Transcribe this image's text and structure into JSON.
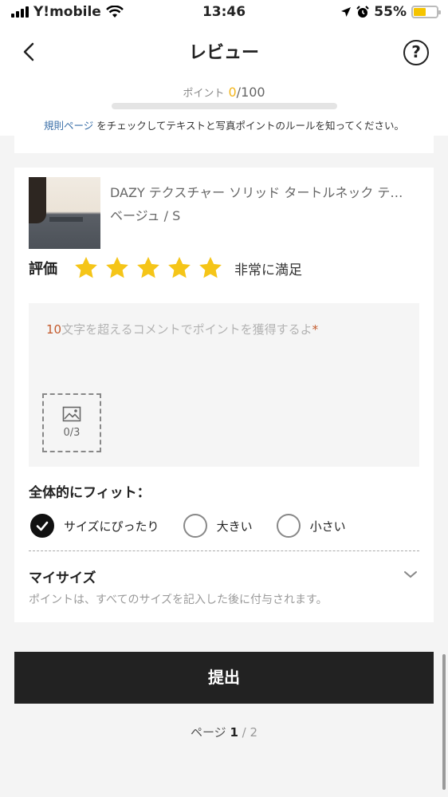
{
  "status_bar": {
    "carrier": "Y!mobile",
    "time": "13:46",
    "battery": "55%"
  },
  "header": {
    "title": "レビュー"
  },
  "points": {
    "label": "ポイント",
    "current": "0",
    "separator_total": "/100",
    "progress": 0
  },
  "rules": {
    "link_text": "規則ページ",
    "text": " をチェックしてテキストと写真ポイントのルールを知ってください。"
  },
  "product": {
    "name": "DAZY テクスチャー ソリッド タートルネック テ…",
    "variant": "ベージュ / S"
  },
  "rating": {
    "label": "評価",
    "stars_filled": 5,
    "stars_total": 5,
    "text": "非常に満足",
    "star_color": "#f5c518"
  },
  "comment": {
    "min_chars": "10",
    "placeholder": "文字を超えるコメントでポイントを獲得するよ",
    "required_mark": "*",
    "upload_count": "0/3"
  },
  "fit": {
    "title": "全体的にフィット：",
    "options": [
      {
        "label": "サイズにぴったり",
        "checked": true
      },
      {
        "label": "大きい",
        "checked": false
      },
      {
        "label": "小さい",
        "checked": false
      }
    ]
  },
  "my_size": {
    "title": "マイサイズ",
    "note": "ポイントは、すべてのサイズを記入した後に付与されます。"
  },
  "submit": {
    "label": "提出"
  },
  "pagination": {
    "label": "ページ ",
    "current": "1",
    "total": " / 2"
  },
  "icons": {
    "back": "chevron-left-icon",
    "help": "question-mark-icon",
    "upload": "image-icon",
    "expand": "chevron-down-icon"
  },
  "colors": {
    "accent": "#f2b51c",
    "link": "#3a6fa8",
    "submit_bg": "#222222"
  }
}
